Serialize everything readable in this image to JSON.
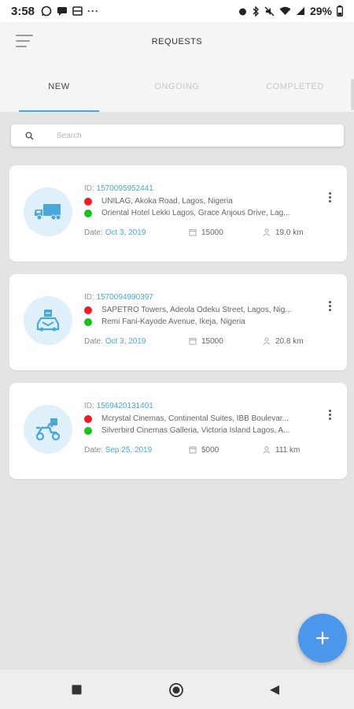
{
  "status_bar": {
    "time": "3:58",
    "battery": "29%",
    "left_icons": [
      "whatsapp-icon",
      "message-icon",
      "gallery-icon",
      "more-dots-icon"
    ],
    "right_icons": [
      "alarm-icon",
      "bluetooth-icon",
      "mute-icon",
      "wifi-icon",
      "signal-icon"
    ]
  },
  "app_bar": {
    "title": "REQUESTS"
  },
  "tabs": [
    {
      "label": "NEW",
      "active": true
    },
    {
      "label": "ONGOING",
      "active": false
    },
    {
      "label": "COMPLETED",
      "active": false
    }
  ],
  "search": {
    "placeholder": "Search",
    "value": ""
  },
  "requests": [
    {
      "id_label": "ID:",
      "id": "1570095952441",
      "icon": "truck-icon",
      "pickup": "UNILAG, Akoka Road, Lagos, Nigeria",
      "dropoff": "Oriental Hotel Lekki Lagos, Grace Anjous Drive, Lag...",
      "date_label": "Date:",
      "date": "Oct 3, 2019",
      "amount": "15000",
      "distance": "19.0 km"
    },
    {
      "id_label": "ID:",
      "id": "1570094990397",
      "icon": "courier-car-icon",
      "pickup": "SAPETRO Towers, Adeola Odeku Street, Lagos, Nig...",
      "dropoff": "Remi Fani-Kayode Avenue, Ikeja, Nigeria",
      "date_label": "Date:",
      "date": "Oct 3, 2019",
      "amount": "15000",
      "distance": "20.8 km"
    },
    {
      "id_label": "ID:",
      "id": "1569420131401",
      "icon": "scooter-icon",
      "pickup": "Mcrystal Cinemas, Continental Suites, IBB Boulevar...",
      "dropoff": "Silverbird Cinemas Galleria, Victoria Island Lagos, A...",
      "date_label": "Date:",
      "date": "Sep 25, 2019",
      "amount": "5000",
      "distance": "111 km"
    }
  ],
  "fab": {
    "icon": "plus-icon"
  },
  "colors": {
    "accent": "#4aa8d8",
    "fab": "#4a97ec",
    "pickup_dot": "#ee1c24",
    "dropoff_dot": "#17c317",
    "avatar_bg": "#dff0fa"
  }
}
